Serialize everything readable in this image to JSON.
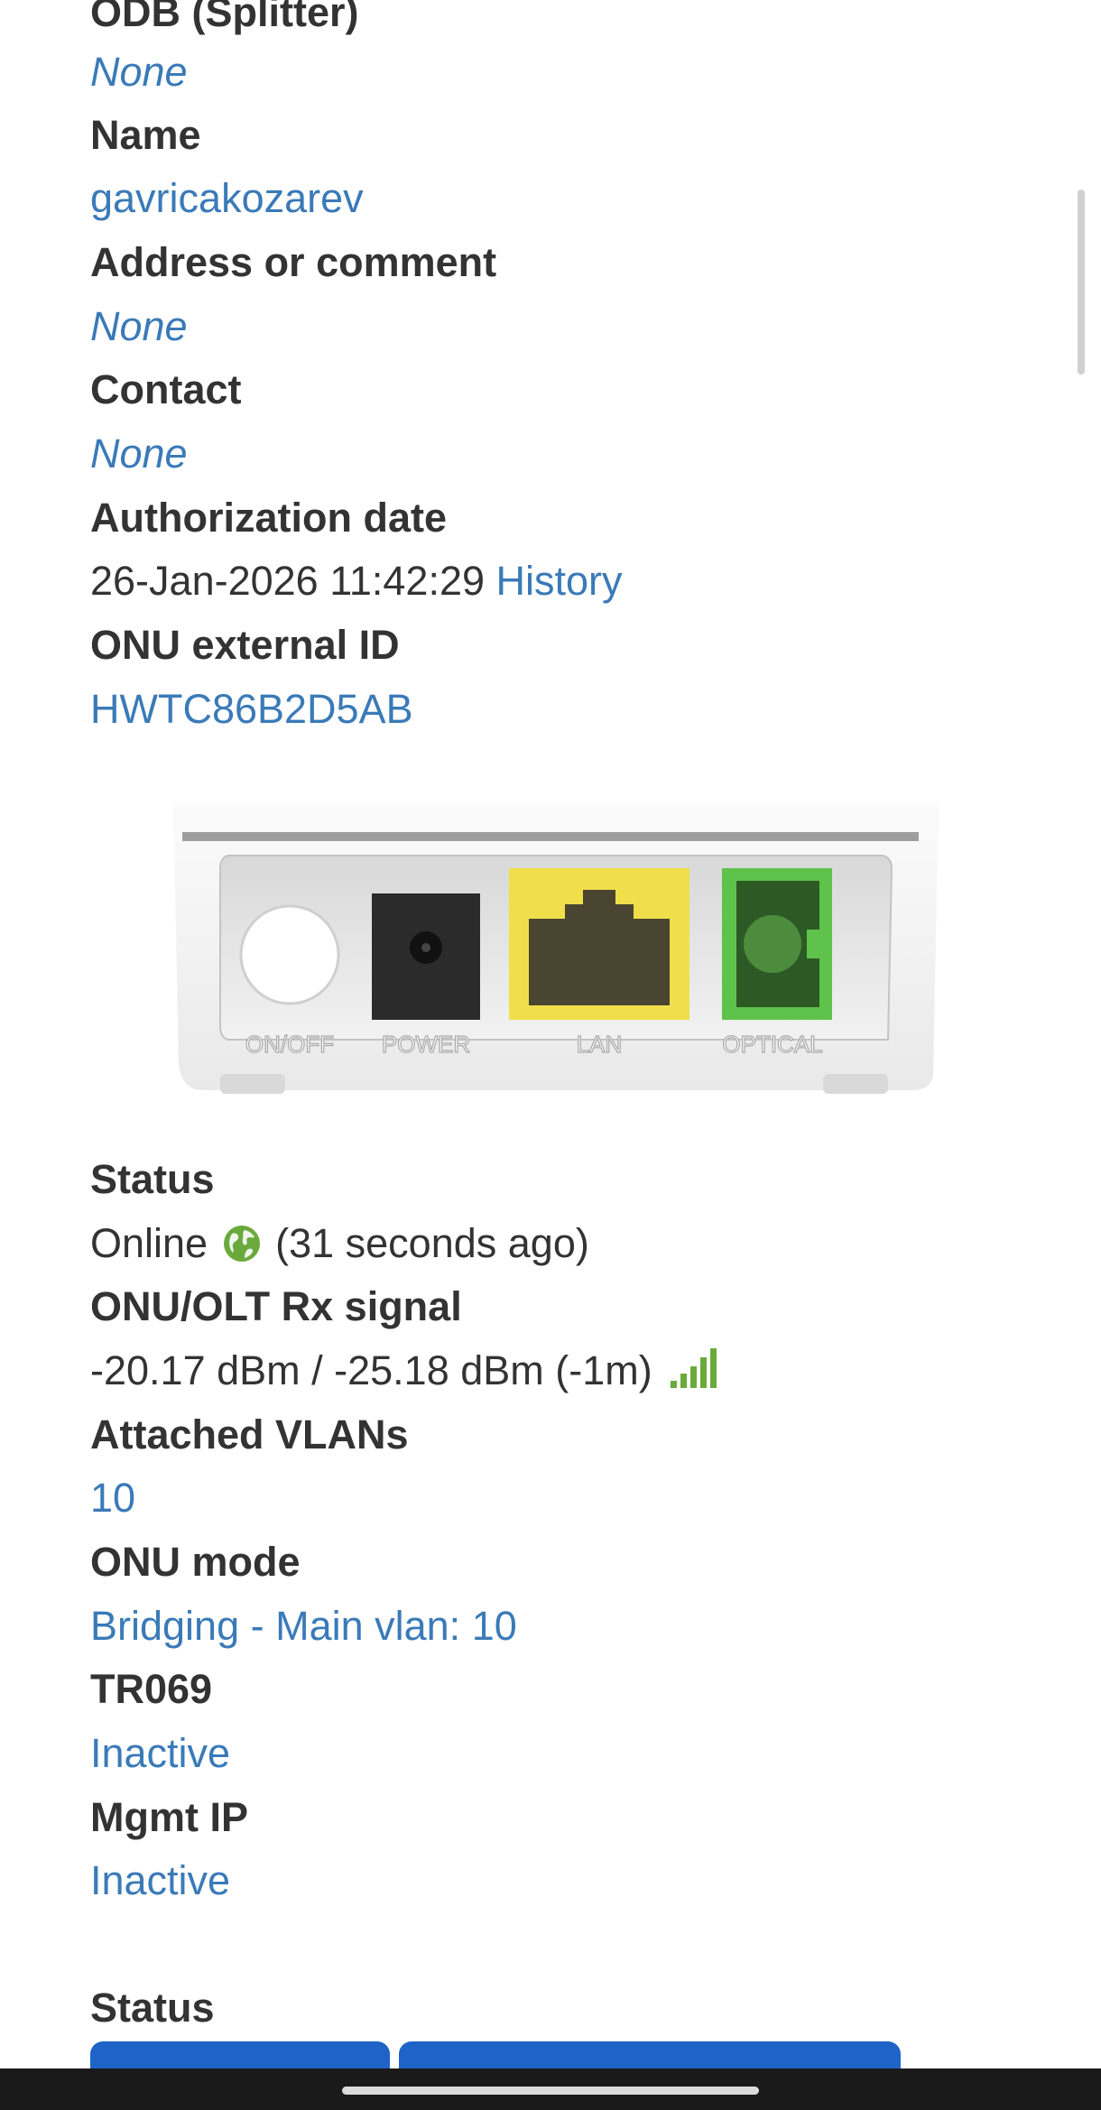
{
  "fields": {
    "odb": {
      "label": "ODB (Splitter)",
      "value": "None"
    },
    "name": {
      "label": "Name",
      "value": "gavricakozarev"
    },
    "address": {
      "label": "Address or comment",
      "value": "None"
    },
    "contact": {
      "label": "Contact",
      "value": "None"
    },
    "auth_date": {
      "label": "Authorization date",
      "value": "26-Jan-2026 11:42:29",
      "history_link": "History"
    },
    "external_id": {
      "label": "ONU external ID",
      "value": "HWTC86B2D5AB"
    },
    "status": {
      "label": "Status",
      "value_online": "Online",
      "value_ago": "(31 seconds ago)"
    },
    "rx_signal": {
      "label": "ONU/OLT Rx signal",
      "value": "-20.17 dBm / -25.18 dBm (-1m)"
    },
    "vlans": {
      "label": "Attached VLANs",
      "value": "10"
    },
    "mode": {
      "label": "ONU mode",
      "value": "Bridging - Main vlan: 10"
    },
    "tr069": {
      "label": "TR069",
      "value": "Inactive"
    },
    "mgmt_ip": {
      "label": "Mgmt IP",
      "value": "Inactive"
    }
  },
  "section": {
    "status_heading": "Status"
  },
  "device_ports": {
    "on_off": "ON/OFF",
    "power": "POWER",
    "lan": "LAN",
    "optical": "OPTICAL"
  },
  "colors": {
    "link": "#3a7ab8",
    "text": "#333333",
    "online_green": "#6aaa3c",
    "button_blue": "#1f63c6",
    "lan_port": "#f0df4a",
    "optical_port": "#5fc24a"
  },
  "icons": {
    "status": "globe-icon",
    "signal": "signal-bars-icon"
  }
}
